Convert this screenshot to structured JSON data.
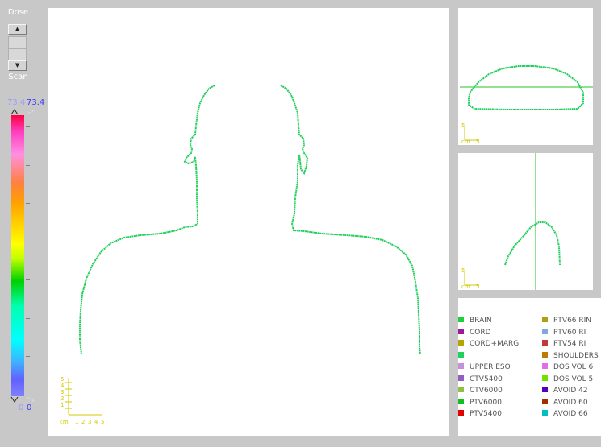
{
  "controls": {
    "dose_label": "Dose",
    "scan_label": "Scan",
    "range_max_left": "73.4",
    "range_max_right": "73.4",
    "range_min_left": "0",
    "range_min_right": "0",
    "colors": {
      "left_value": "#9b9bff",
      "right_value": "#3a3aff"
    }
  },
  "views": {
    "main": {
      "scale_unit": "cm",
      "scale_ticks": [
        "1",
        "2",
        "3",
        "4",
        "5"
      ],
      "scale_vticks": [
        "1",
        "2",
        "3",
        "4",
        "5"
      ]
    },
    "top_right": {
      "scale_unit": "cm",
      "scale_tick": "5",
      "scale_vtick": "5"
    },
    "mid_right": {
      "scale_unit": "cm",
      "scale_tick": "5",
      "scale_vtick": "5"
    }
  },
  "legend": {
    "left": [
      {
        "label": "BRAIN",
        "color": "#1fcf3a"
      },
      {
        "label": "CORD",
        "color": "#9a1a9a"
      },
      {
        "label": "CORD+MARG",
        "color": "#b3a600"
      },
      {
        "label": "",
        "color": "#22d060"
      },
      {
        "label": "UPPER ESO",
        "color": "#c890d8"
      },
      {
        "label": "CTV5400",
        "color": "#9060c0"
      },
      {
        "label": "CTV6000",
        "color": "#90c040"
      },
      {
        "label": "PTV6000",
        "color": "#10c020"
      },
      {
        "label": "PTV5400",
        "color": "#e00000"
      }
    ],
    "right": [
      {
        "label": "PTV66 RIN",
        "color": "#b0a010"
      },
      {
        "label": "PTV60 RI",
        "color": "#80a8d8"
      },
      {
        "label": "PTV54 RI",
        "color": "#c03a3a"
      },
      {
        "label": "SHOULDERS",
        "color": "#c07a00"
      },
      {
        "label": "DOS VOL 6",
        "color": "#e070e0"
      },
      {
        "label": "DOS VOL 5",
        "color": "#70e000"
      },
      {
        "label": "AVOID 42",
        "color": "#5000c0"
      },
      {
        "label": "AVOID 60",
        "color": "#a03000"
      },
      {
        "label": "AVOID 66",
        "color": "#00c0c0"
      }
    ]
  }
}
